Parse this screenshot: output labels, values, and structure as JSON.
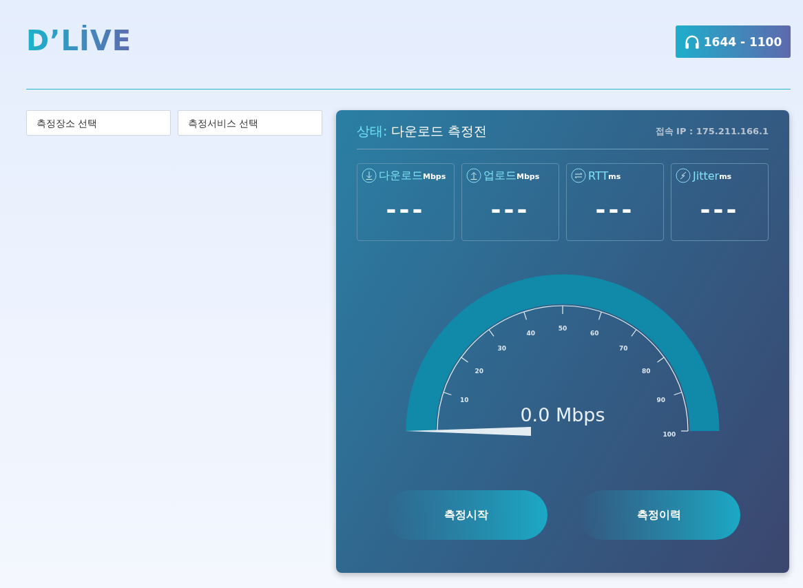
{
  "header": {
    "logo": "D’LİVE",
    "phone": "1644 - 1100"
  },
  "selects": [
    {
      "placeholder": "측정장소 선택"
    },
    {
      "placeholder": "측정서비스 선택"
    }
  ],
  "panel": {
    "status_label": "상태:",
    "status": "다운로드 측정전",
    "ip": "접속 IP : 175.211.166.1",
    "metrics": [
      {
        "kind": "download",
        "label": "다운로드",
        "unit": "Mbps",
        "value": "---"
      },
      {
        "kind": "upload",
        "label": "업로드",
        "unit": "Mbps",
        "value": "---"
      },
      {
        "kind": "rtt",
        "label": "RTT",
        "unit": "ms",
        "value": "---"
      },
      {
        "kind": "jitter",
        "label": "Jitter",
        "unit": "ms",
        "value": "---"
      }
    ],
    "gauge": {
      "ticks": [
        "10",
        "20",
        "30",
        "40",
        "50",
        "60",
        "70",
        "80",
        "90",
        "100"
      ],
      "reading": "0.0 Mbps"
    },
    "buttons": [
      "측정시작",
      "측정이력"
    ]
  }
}
